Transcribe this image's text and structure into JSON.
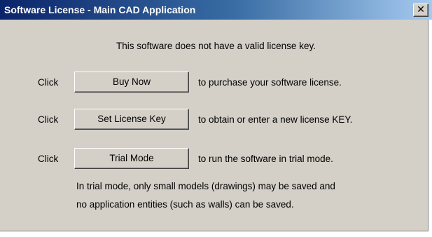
{
  "window": {
    "title": "Software License - Main CAD Application",
    "close_glyph": "✕",
    "close_icon": "close-icon"
  },
  "main": {
    "intro": "This software does not have a valid license key.",
    "rows": [
      {
        "prefix": "Click",
        "button_label": "Buy Now",
        "description": "to purchase your software license."
      },
      {
        "prefix": "Click",
        "button_label": "Set License Key",
        "description": "to obtain or enter a new license KEY."
      },
      {
        "prefix": "Click",
        "button_label": "Trial Mode",
        "description": "to run the software in trial mode."
      }
    ],
    "note_lines": [
      "In trial mode, only small models (drawings) may be saved and",
      "no application entities (such as walls) can be saved."
    ]
  },
  "colors": {
    "title_bar_start": "#0a246a",
    "title_bar_end": "#a6caf0",
    "dialog_face": "#d4d0c8"
  }
}
